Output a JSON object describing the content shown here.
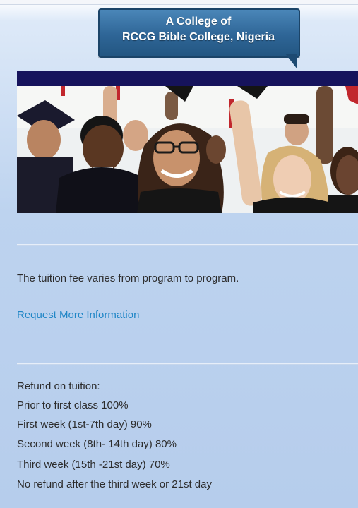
{
  "header": {
    "banner_line1": "A College of",
    "banner_line2": "RCCG Bible College, Nigeria"
  },
  "hero": {
    "image": "graduates-celebrating-photo"
  },
  "content": {
    "tuition_text": "The tuition fee varies from program to program.",
    "request_link": "Request More Information",
    "refund_title": "Refund on tuition:",
    "refund_items": [
      "Prior to first class 100%",
      "First week (1st-7th day) 90%",
      "Second week (8th- 14th day) 80%",
      "Third week (15th -21st day) 70%",
      "No refund after the third week or 21st day"
    ]
  },
  "colors": {
    "navbar": "#16135c",
    "banner": "#2e6596",
    "link": "#1f86c6"
  }
}
